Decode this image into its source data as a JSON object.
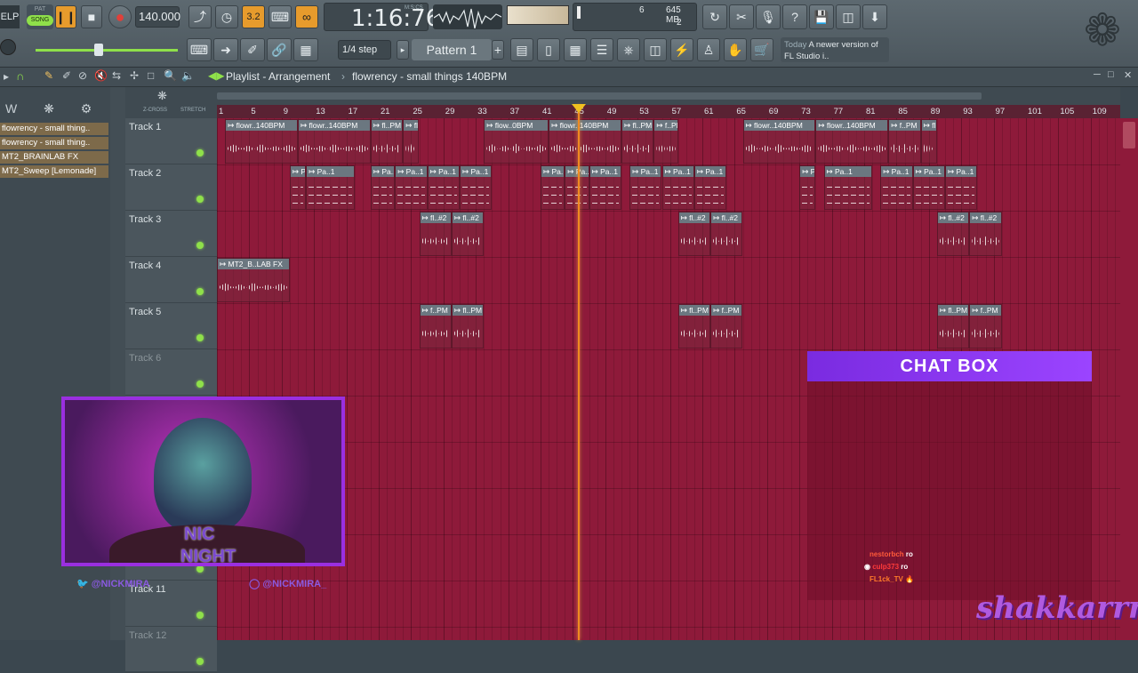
{
  "toolbar": {
    "mode_label": "ELP",
    "pat_label": "PAT",
    "song_label": "SONG",
    "tempo": "140.000",
    "time_display": "1:16:76",
    "time_unit": "M:S:CS",
    "cpu_value": "6",
    "memory": "645 MB",
    "poly_value": "2",
    "step_label": "1/4 step",
    "pattern_label": "Pattern 1",
    "hint_title": "Today",
    "hint_text": "A newer version of FL Studio i..",
    "icons": [
      "play-icon",
      "stop-icon",
      "record-icon",
      "metronome-icon",
      "undo-icon",
      "cut-icon",
      "mic-icon",
      "help-icon",
      "save-icon",
      "render-icon",
      "download-icon"
    ]
  },
  "breadcrumb": {
    "window": "Playlist - Arrangement",
    "project": "flowrency - small things 140BPM"
  },
  "browser": {
    "items": [
      "flowrency - small thing..",
      "flowrency - small thing..",
      "MT2_BRAINLAB FX",
      "MT2_Sweep [Lemonade]"
    ]
  },
  "ruler": {
    "zcross": "Z-CROSS",
    "stretch": "STRETCH",
    "bars": [
      "1",
      "5",
      "9",
      "13",
      "17",
      "21",
      "25",
      "29",
      "33",
      "37",
      "41",
      "45",
      "49",
      "53",
      "57",
      "61",
      "65",
      "69",
      "73",
      "77",
      "81",
      "85",
      "89",
      "93",
      "97",
      "101",
      "105",
      "109"
    ]
  },
  "tracks": [
    "Track 1",
    "Track 2",
    "Track 3",
    "Track 4",
    "Track 5",
    "Track 6",
    "",
    "",
    "",
    "",
    "Track 11",
    "Track 12"
  ],
  "clips": {
    "t1a": "flowr..140BPM",
    "t1b": "flowr..140BPM",
    "t1c": "fl..PM",
    "t1d": "fl..PM",
    "t1e": "flow..0BPM",
    "t1f": "flowr..140BPM",
    "t1g": "fl..PM",
    "t1h": "f..PM",
    "t1i": "flowr..140BPM",
    "t1j": "flowr..140BPM",
    "t1k": "f..PM",
    "t1l": "fl..PM",
    "pa": "Pa..1",
    "t3a": "fl..#2",
    "t3b": "fl..#2",
    "t4": "MT2_B..LAB FX",
    "t5a": "f..PM",
    "t5b": "fl..PM"
  },
  "chat": {
    "title": "CHAT BOX",
    "messages": [
      {
        "user": "nestorbch",
        "text": "ro"
      },
      {
        "user": "culp373",
        "text": "ro"
      },
      {
        "user": "FL1ck_TV",
        "text": "🔥"
      }
    ]
  },
  "overlay": {
    "cam_label_1": "NIC",
    "cam_label_2": "NIGHT",
    "twitter": "@NICKMIRA",
    "instagram": "@NICKMIRA_",
    "watermark": "shakkarrr"
  },
  "colors": {
    "playlist_bg": "#8e1a3a",
    "playhead": "#f08a20",
    "chat_header": "#8a3cf0",
    "led": "#8fe04a"
  }
}
